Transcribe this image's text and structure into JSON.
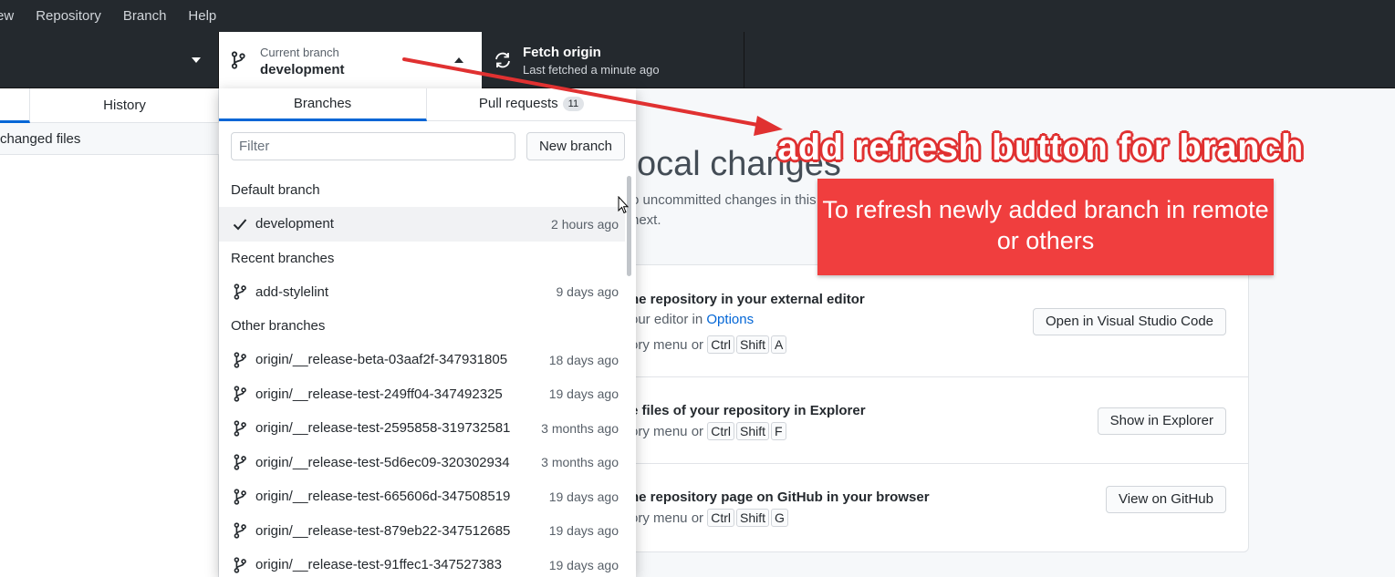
{
  "menu": {
    "items": [
      "ew",
      "Repository",
      "Branch",
      "Help"
    ]
  },
  "toolbar": {
    "current_branch_label": "Current branch",
    "current_branch_name": "development",
    "fetch_title": "Fetch origin",
    "fetch_subtitle": "Last fetched a minute ago"
  },
  "sidebar": {
    "history_tab": "History",
    "changed_files": "changed files"
  },
  "main": {
    "title": "ocal changes",
    "desc_line1": "o uncommitted changes in this",
    "desc_line2": "next.",
    "suggestions": [
      {
        "title": "he repository in your external editor",
        "desc_prefix": "our editor in ",
        "desc_link": "Options",
        "shortcut_prefix": "ory menu or ",
        "keys": [
          "Ctrl",
          "Shift",
          "A"
        ],
        "button": "Open in Visual Studio Code"
      },
      {
        "title": "e files of your repository in Explorer",
        "shortcut_prefix": "ory menu or ",
        "keys": [
          "Ctrl",
          "Shift",
          "F"
        ],
        "button": "Show in Explorer"
      },
      {
        "title": "he repository page on GitHub in your browser",
        "shortcut_prefix": "ory menu or ",
        "keys": [
          "Ctrl",
          "Shift",
          "G"
        ],
        "button": "View on GitHub"
      }
    ]
  },
  "dropdown": {
    "tab_branches": "Branches",
    "tab_pull_requests": "Pull requests",
    "pull_request_count": "11",
    "filter_placeholder": "Filter",
    "new_branch_button": "New branch",
    "default_header": "Default branch",
    "recent_header": "Recent branches",
    "other_header": "Other branches",
    "default_branches": [
      {
        "name": "development",
        "time": "2 hours ago",
        "selected": true
      }
    ],
    "recent_branches": [
      {
        "name": "add-stylelint",
        "time": "9 days ago"
      }
    ],
    "other_branches": [
      {
        "name": "origin/__release-beta-03aaf2f-347931805",
        "time": "18 days ago"
      },
      {
        "name": "origin/__release-test-249ff04-347492325",
        "time": "19 days ago"
      },
      {
        "name": "origin/__release-test-2595858-319732581",
        "time": "3 months ago"
      },
      {
        "name": "origin/__release-test-5d6ec09-320302934",
        "time": "3 months ago"
      },
      {
        "name": "origin/__release-test-665606d-347508519",
        "time": "19 days ago"
      },
      {
        "name": "origin/__release-test-879eb22-347512685",
        "time": "19 days ago"
      },
      {
        "name": "origin/__release-test-91ffec1-347527383",
        "time": "19 days ago"
      }
    ]
  },
  "annotation": {
    "title": "add refresh button for branch",
    "note": "To refresh newly added branch in remote or others",
    "color": "#f03e3e"
  },
  "colors": {
    "toolbar_bg": "#24292e",
    "accent": "#0366d6",
    "annotation_red": "#e03131"
  }
}
